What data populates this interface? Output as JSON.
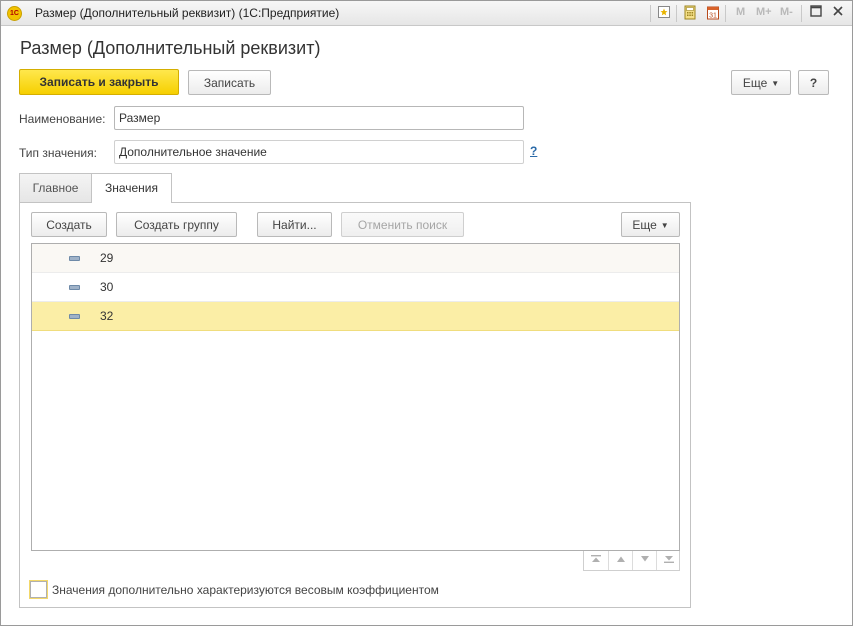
{
  "window": {
    "title": "Размер (Дополнительный реквизит)  (1С:Предприятие)",
    "app_logo": "1С",
    "memory_buttons": [
      "M",
      "M+",
      "M-"
    ],
    "icons": [
      "favorite-icon",
      "calculator-icon",
      "calendar-icon",
      "restore-window-icon",
      "close-icon"
    ]
  },
  "form": {
    "title": "Размер (Дополнительный реквизит)"
  },
  "toolbar": {
    "save_close_label": "Записать и закрыть",
    "save_label": "Записать",
    "more_label": "Еще",
    "help_label": "?"
  },
  "fields": {
    "name_label": "Наименование:",
    "name_value": "Размер",
    "type_label": "Тип значения:",
    "type_value": "Дополнительное значение",
    "type_help": "?"
  },
  "tabs": [
    {
      "label": "Главное",
      "active": false
    },
    {
      "label": "Значения",
      "active": true
    }
  ],
  "values_toolbar": {
    "create_label": "Создать",
    "create_group_label": "Создать группу",
    "find_label": "Найти...",
    "cancel_search_label": "Отменить поиск",
    "more_label": "Еще"
  },
  "values_list": {
    "rows": [
      {
        "value": "29",
        "selected": false
      },
      {
        "value": "30",
        "selected": false
      },
      {
        "value": "32",
        "selected": true
      }
    ]
  },
  "weight_checkbox": {
    "label": "Значения дополнительно характеризуются весовым коэффициентом",
    "checked": false
  },
  "colors": {
    "primary_button": "#f6cf00",
    "selected_row": "#fbeea6",
    "link": "#2a6aa8"
  }
}
